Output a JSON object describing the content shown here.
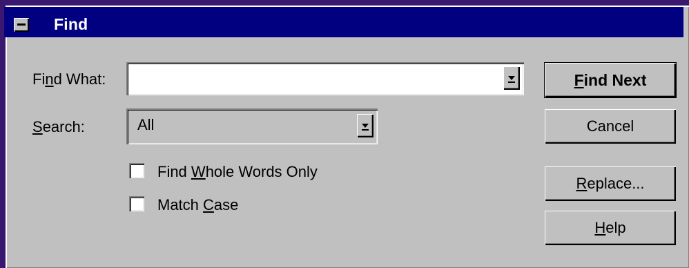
{
  "dialog": {
    "title": "Find"
  },
  "find_what": {
    "label_before": "Fi",
    "label_mnemonic": "n",
    "label_after": "d What:",
    "value": ""
  },
  "search": {
    "label_mnemonic": "S",
    "label_after": "earch:",
    "value": "All"
  },
  "options": {
    "whole_words_before": "Find ",
    "whole_words_mnemonic": "W",
    "whole_words_after": "hole Words Only",
    "whole_words_checked": false,
    "match_case_before": "Match ",
    "match_case_mnemonic": "C",
    "match_case_after": "ase",
    "match_case_checked": false
  },
  "buttons": {
    "find_next_mnemonic": "F",
    "find_next_after": "ind Next",
    "cancel": "Cancel",
    "replace_mnemonic": "R",
    "replace_after": "eplace...",
    "help_mnemonic": "H",
    "help_after": "elp"
  },
  "colors": {
    "titlebar": "#000080",
    "dialog_face": "#c0c0c0",
    "desktop": "#3a1870"
  },
  "icons": {
    "system_menu": "minus-box-icon",
    "dropdown": "down-arrow-icon"
  }
}
